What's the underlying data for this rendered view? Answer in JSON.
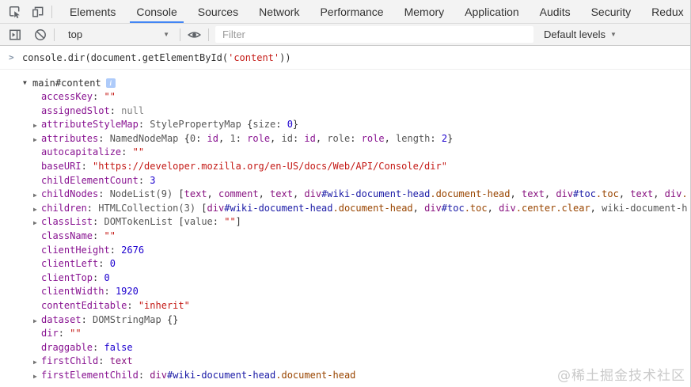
{
  "header": {
    "tabs": [
      {
        "label": "Elements",
        "active": false
      },
      {
        "label": "Console",
        "active": true
      },
      {
        "label": "Sources",
        "active": false
      },
      {
        "label": "Network",
        "active": false
      },
      {
        "label": "Performance",
        "active": false
      },
      {
        "label": "Memory",
        "active": false
      },
      {
        "label": "Application",
        "active": false
      },
      {
        "label": "Audits",
        "active": false
      },
      {
        "label": "Security",
        "active": false
      },
      {
        "label": "Redux",
        "active": false
      }
    ],
    "icons": [
      "inspect-element-icon",
      "toggle-device-toolbar-icon"
    ]
  },
  "toolbar": {
    "icons": [
      "console-sidebar-icon",
      "clear-console-icon",
      "live-expression-eye-icon"
    ],
    "context": "top",
    "filter_placeholder": "Filter",
    "levels": "Default levels"
  },
  "colors": {
    "accent_tab_underline": "#4285f4",
    "property_name": "#881391",
    "string": "#c41a16",
    "number": "#1c00cf",
    "node_tag": "#881280",
    "node_id": "#1a1aa6",
    "node_class": "#994500",
    "badge_bg": "#aecbfa"
  },
  "console": {
    "command": [
      [
        "console.dir(document.getElementById(",
        "plain"
      ],
      [
        "'content'",
        "str"
      ],
      [
        "))",
        "plain"
      ]
    ],
    "object": {
      "header": {
        "text": "main#content",
        "badge": "i"
      },
      "rows": [
        {
          "expand": "none",
          "segments": [
            [
              "accessKey",
              "name"
            ],
            [
              ": ",
              "plain"
            ],
            [
              "\"\"",
              "str"
            ]
          ]
        },
        {
          "expand": "none",
          "segments": [
            [
              "assignedSlot",
              "name"
            ],
            [
              ": ",
              "plain"
            ],
            [
              "null",
              "nul"
            ]
          ]
        },
        {
          "expand": "closed",
          "segments": [
            [
              "attributeStyleMap",
              "name"
            ],
            [
              ": ",
              "plain"
            ],
            [
              "StylePropertyMap",
              "gray"
            ],
            [
              " {",
              "plain"
            ],
            [
              "size",
              "gray"
            ],
            [
              ": ",
              "plain"
            ],
            [
              "0",
              "num"
            ],
            [
              "}",
              "plain"
            ]
          ]
        },
        {
          "expand": "closed",
          "segments": [
            [
              "attributes",
              "name"
            ],
            [
              ": ",
              "plain"
            ],
            [
              "NamedNodeMap",
              "gray"
            ],
            [
              " {",
              "plain"
            ],
            [
              "0",
              "gray"
            ],
            [
              ": ",
              "plain"
            ],
            [
              "id",
              "name"
            ],
            [
              ", ",
              "plain"
            ],
            [
              "1",
              "gray"
            ],
            [
              ": ",
              "plain"
            ],
            [
              "role",
              "name"
            ],
            [
              ", ",
              "plain"
            ],
            [
              "id",
              "gray"
            ],
            [
              ": ",
              "plain"
            ],
            [
              "id",
              "name"
            ],
            [
              ", ",
              "plain"
            ],
            [
              "role",
              "gray"
            ],
            [
              ": ",
              "plain"
            ],
            [
              "role",
              "name"
            ],
            [
              ", ",
              "plain"
            ],
            [
              "length",
              "gray"
            ],
            [
              ": ",
              "plain"
            ],
            [
              "2",
              "num"
            ],
            [
              "}",
              "plain"
            ]
          ]
        },
        {
          "expand": "none",
          "segments": [
            [
              "autocapitalize",
              "name"
            ],
            [
              ": ",
              "plain"
            ],
            [
              "\"\"",
              "str"
            ]
          ]
        },
        {
          "expand": "none",
          "segments": [
            [
              "baseURI",
              "name"
            ],
            [
              ": ",
              "plain"
            ],
            [
              "\"https://developer.mozilla.org/en-US/docs/Web/API/Console/dir\"",
              "str"
            ]
          ]
        },
        {
          "expand": "none",
          "segments": [
            [
              "childElementCount",
              "name"
            ],
            [
              ": ",
              "plain"
            ],
            [
              "3",
              "num"
            ]
          ]
        },
        {
          "expand": "closed",
          "segments": [
            [
              "childNodes",
              "name"
            ],
            [
              ": ",
              "plain"
            ],
            [
              "NodeList(9)",
              "gray"
            ],
            [
              " [",
              "plain"
            ],
            [
              "text",
              "tag"
            ],
            [
              ", ",
              "plain"
            ],
            [
              "comment",
              "tag"
            ],
            [
              ", ",
              "plain"
            ],
            [
              "text",
              "tag"
            ],
            [
              ", ",
              "plain"
            ],
            [
              "div",
              "tag"
            ],
            [
              "#wiki-document-head",
              "id"
            ],
            [
              ".document-head",
              "cls"
            ],
            [
              ", ",
              "plain"
            ],
            [
              "text",
              "tag"
            ],
            [
              ", ",
              "plain"
            ],
            [
              "div",
              "tag"
            ],
            [
              "#toc",
              "id"
            ],
            [
              ".toc",
              "cls"
            ],
            [
              ", ",
              "plain"
            ],
            [
              "text",
              "tag"
            ],
            [
              ", ",
              "plain"
            ],
            [
              "div",
              "tag"
            ],
            [
              ".",
              "cls"
            ]
          ]
        },
        {
          "expand": "closed",
          "segments": [
            [
              "children",
              "name"
            ],
            [
              ": ",
              "plain"
            ],
            [
              "HTMLCollection(3)",
              "gray"
            ],
            [
              " [",
              "plain"
            ],
            [
              "div",
              "tag"
            ],
            [
              "#wiki-document-head",
              "id"
            ],
            [
              ".document-head",
              "cls"
            ],
            [
              ", ",
              "plain"
            ],
            [
              "div",
              "tag"
            ],
            [
              "#toc",
              "id"
            ],
            [
              ".toc",
              "cls"
            ],
            [
              ", ",
              "plain"
            ],
            [
              "div",
              "tag"
            ],
            [
              ".center.clear",
              "cls"
            ],
            [
              ", ",
              "plain"
            ],
            [
              "wiki-document-h",
              "gray"
            ]
          ]
        },
        {
          "expand": "closed",
          "segments": [
            [
              "classList",
              "name"
            ],
            [
              ": ",
              "plain"
            ],
            [
              "DOMTokenList",
              "gray"
            ],
            [
              " [",
              "plain"
            ],
            [
              "value",
              "gray"
            ],
            [
              ": ",
              "plain"
            ],
            [
              "\"\"",
              "str"
            ],
            [
              "]",
              "plain"
            ]
          ]
        },
        {
          "expand": "none",
          "segments": [
            [
              "className",
              "name"
            ],
            [
              ": ",
              "plain"
            ],
            [
              "\"\"",
              "str"
            ]
          ]
        },
        {
          "expand": "none",
          "segments": [
            [
              "clientHeight",
              "name"
            ],
            [
              ": ",
              "plain"
            ],
            [
              "2676",
              "num"
            ]
          ]
        },
        {
          "expand": "none",
          "segments": [
            [
              "clientLeft",
              "name"
            ],
            [
              ": ",
              "plain"
            ],
            [
              "0",
              "num"
            ]
          ]
        },
        {
          "expand": "none",
          "segments": [
            [
              "clientTop",
              "name"
            ],
            [
              ": ",
              "plain"
            ],
            [
              "0",
              "num"
            ]
          ]
        },
        {
          "expand": "none",
          "segments": [
            [
              "clientWidth",
              "name"
            ],
            [
              ": ",
              "plain"
            ],
            [
              "1920",
              "num"
            ]
          ]
        },
        {
          "expand": "none",
          "segments": [
            [
              "contentEditable",
              "name"
            ],
            [
              ": ",
              "plain"
            ],
            [
              "\"inherit\"",
              "str"
            ]
          ]
        },
        {
          "expand": "closed",
          "segments": [
            [
              "dataset",
              "name"
            ],
            [
              ": ",
              "plain"
            ],
            [
              "DOMStringMap",
              "gray"
            ],
            [
              " {}",
              "plain"
            ]
          ]
        },
        {
          "expand": "none",
          "segments": [
            [
              "dir",
              "name"
            ],
            [
              ": ",
              "plain"
            ],
            [
              "\"\"",
              "str"
            ]
          ]
        },
        {
          "expand": "none",
          "segments": [
            [
              "draggable",
              "name"
            ],
            [
              ": ",
              "plain"
            ],
            [
              "false",
              "num"
            ]
          ]
        },
        {
          "expand": "closed",
          "segments": [
            [
              "firstChild",
              "name"
            ],
            [
              ": ",
              "plain"
            ],
            [
              "text",
              "tag"
            ]
          ]
        },
        {
          "expand": "closed",
          "segments": [
            [
              "firstElementChild",
              "name"
            ],
            [
              ": ",
              "plain"
            ],
            [
              "div",
              "tag"
            ],
            [
              "#wiki-document-head",
              "id"
            ],
            [
              ".document-head",
              "cls"
            ]
          ]
        }
      ]
    }
  },
  "watermark": "@稀土掘金技术社区"
}
